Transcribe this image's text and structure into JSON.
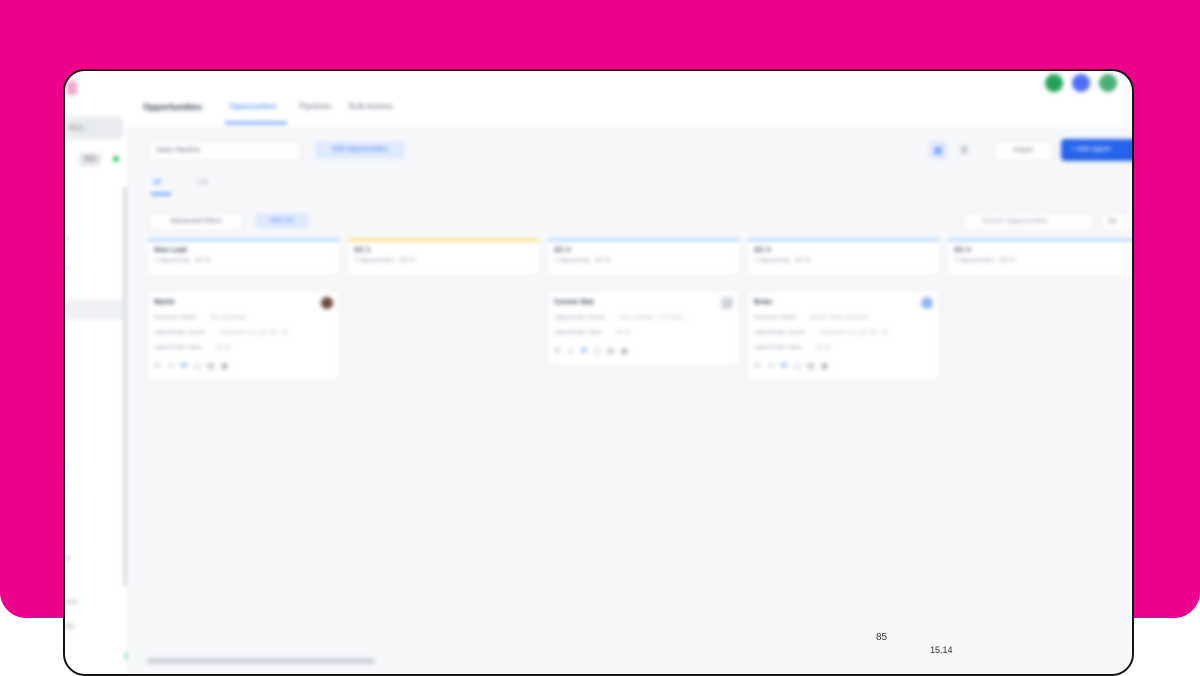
{
  "sidebar": {
    "account_select": "Acc...",
    "count_badge": "302",
    "items": [
      "s",
      "s",
      "l",
      "r",
      "t",
      "ts",
      "ests",
      "elp"
    ],
    "colors": {
      "status_dot": "#22c55e"
    }
  },
  "header": {
    "title": "Opportunities",
    "tabs": [
      {
        "label": "Opportunities",
        "active": true
      },
      {
        "label": "Pipelines",
        "active": false
      },
      {
        "label": "Bulk Actions",
        "active": false
      }
    ],
    "avatars": [
      "#22a35a",
      "#4f6ef7",
      "#4caf7a"
    ]
  },
  "toolbar": {
    "pipeline_select": "Sales Pipeline",
    "edit_button": "Edit Opportunities",
    "grid_icon": "grid-icon",
    "list_icon": "list-icon",
    "import_label": "Import",
    "add_label": "+ Add opport"
  },
  "subtabs": [
    {
      "label": "All",
      "active": true
    },
    {
      "label": "List",
      "active": false
    }
  ],
  "filters": {
    "advanced_label": "Advanced Filters",
    "sort_label": "Sort (1)",
    "search_placeholder": "Search Opportunities",
    "columns_label": "Co"
  },
  "columns": [
    {
      "title": "New Lead",
      "meta": "1 Opportunity  ·  $0.00",
      "cards": [
        {
          "name": "Mariia",
          "avatar_color": "#6b4a3a",
          "rows": [
            {
              "label": "Business Name",
              "value": "Not Specified"
            },
            {
              "label": "Opportunity Source",
              "value": "Leadiance CL (10.29) - w..."
            },
            {
              "label": "Opportunity Value",
              "value": "$0.00"
            }
          ]
        }
      ]
    },
    {
      "title": "GC 1",
      "meta": "0 Opportunities  ·  $0.00",
      "cards": []
    },
    {
      "title": "GC 2",
      "meta": "1 Opportunity  ·  $0.00",
      "cards": [
        {
          "name": "Connor Bair",
          "avatar_color": "#d1d5db",
          "rows": [
            {
              "label": "Opportunity Source",
              "value": "Zoe Linkedin - 07/13/22..."
            },
            {
              "label": "Opportunity Value",
              "value": "$0.00"
            }
          ]
        }
      ]
    },
    {
      "title": "GC 3",
      "meta": "1 Opportunity  ·  $0.00",
      "cards": [
        {
          "name": "Brian",
          "avatar_color": "#93b4f5",
          "rows": [
            {
              "label": "Business Name",
              "value": "Brian's Web Solutions"
            },
            {
              "label": "Opportunity Source",
              "value": "Leadiance CL (10.29) - w..."
            },
            {
              "label": "Opportunity Value",
              "value": "$0.00"
            }
          ]
        }
      ]
    },
    {
      "title": "GC 4",
      "meta": "0 Opportunities  ·  $0.00",
      "cards": []
    }
  ],
  "overlay": {
    "number": "85",
    "time": "15.14"
  },
  "colors": {
    "brand_magenta": "#ec008c",
    "accent_blue": "#2563eb"
  }
}
